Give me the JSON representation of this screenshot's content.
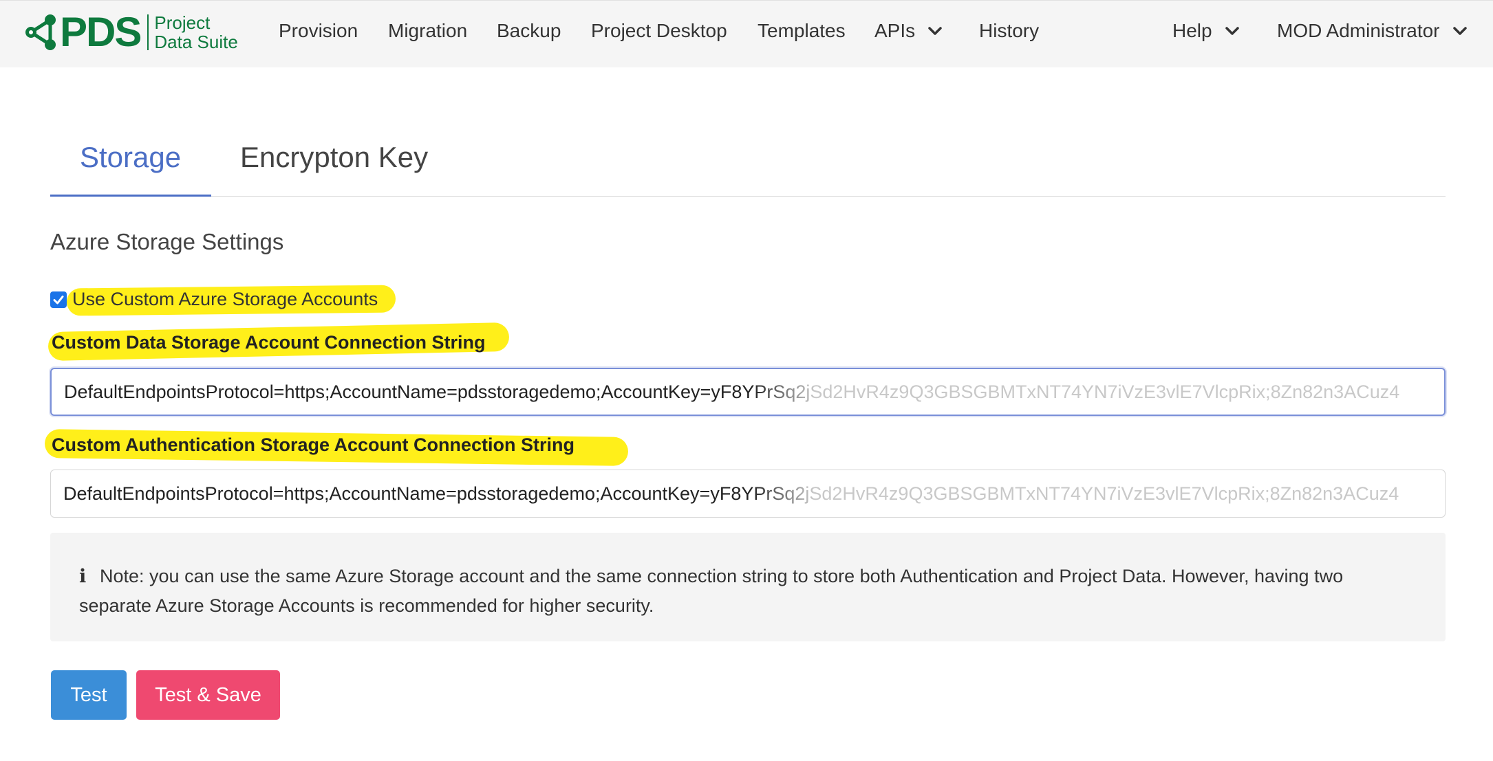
{
  "brand": {
    "logo_text": "PDS",
    "name_line1": "Project",
    "name_line2": "Data Suite",
    "color": "#0e7a3e"
  },
  "nav": {
    "items": [
      {
        "label": "Provision"
      },
      {
        "label": "Migration"
      },
      {
        "label": "Backup"
      },
      {
        "label": "Project Desktop"
      },
      {
        "label": "Templates"
      },
      {
        "label": "APIs",
        "icon": "chevron-down-icon"
      },
      {
        "label": "History"
      }
    ],
    "help": {
      "label": "Help",
      "icon": "chevron-down-icon"
    },
    "user": {
      "label": "MOD Administrator",
      "icon": "chevron-down-icon"
    }
  },
  "tabs": [
    {
      "label": "Storage",
      "active": true
    },
    {
      "label": "Encrypton Key",
      "active": false
    }
  ],
  "form": {
    "section_title": "Azure Storage Settings",
    "use_custom": {
      "label": "Use Custom Azure Storage Accounts",
      "checked": true
    },
    "data_conn": {
      "label": "Custom Data Storage Account Connection String",
      "value": "DefaultEndpointsProtocol=https;AccountName=pdsstoragedemo;AccountKey=yF8YPrSq2jSd2HvR4z9Q3GBSGBMTxNT74YN7iVzE3vlE7VlcpRix;8Zn82n3ACuz4"
    },
    "auth_conn": {
      "label": "Custom Authentication Storage Account Connection String",
      "value": "DefaultEndpointsProtocol=https;AccountName=pdsstoragedemo;AccountKey=yF8YPrSq2jSd2HvR4z9Q3GBSGBMTxNT74YN7iVzE3vlE7VlcpRix;8Zn82n3ACuz4"
    },
    "note": "Note: you can use the same Azure Storage account and the same connection string to store both Authentication and Project Data. However, having two separate Azure Storage Accounts is recommended for higher security.",
    "note_icon": "info-icon"
  },
  "buttons": {
    "test": "Test",
    "test_save": "Test & Save"
  },
  "colors": {
    "accent": "#4b6ec5",
    "highlight": "#ffef1a",
    "test_button": "#3b8ed8",
    "save_button": "#ef4970"
  }
}
